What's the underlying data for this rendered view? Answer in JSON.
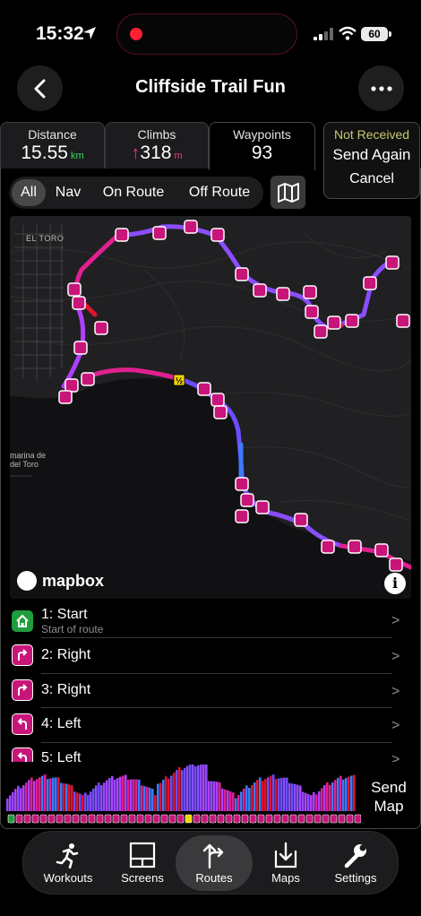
{
  "status_bar": {
    "time": "15:32",
    "battery": "60"
  },
  "header": {
    "title": "Cliffside Trail Fun"
  },
  "stats": {
    "distance": {
      "label": "Distance",
      "value": "15.55",
      "unit": "km"
    },
    "climbs": {
      "label": "Climbs",
      "arrow": "↑",
      "value": "318",
      "unit": "m"
    },
    "waypoints": {
      "label": "Waypoints",
      "value": "93"
    }
  },
  "sync_card": {
    "status": "Not Received",
    "send_again": "Send Again",
    "cancel": "Cancel"
  },
  "filters": {
    "all": "All",
    "nav": "Nav",
    "on_route": "On Route",
    "off_route": "Off Route",
    "selected": "All"
  },
  "map": {
    "labels": {
      "town_north": "EL TORO",
      "town_west_1": "marina de",
      "town_west_2": "del Toro"
    },
    "halfway_marker": "½",
    "attribution": "mapbox",
    "info": "i"
  },
  "waypoint_list": [
    {
      "name": "1: Start",
      "description": "Start of route",
      "icon": "home-icon"
    },
    {
      "name": "2: Right",
      "icon": "turn-right-icon"
    },
    {
      "name": "3: Right",
      "icon": "turn-right-icon"
    },
    {
      "name": "4: Left",
      "icon": "turn-left-icon"
    },
    {
      "name": "5: Left",
      "icon": "turn-left-icon"
    }
  ],
  "chevron": ">",
  "send_map": {
    "line1": "Send",
    "line2": "Map"
  },
  "tab_bar": [
    {
      "label": "Workouts",
      "icon": "runner-icon"
    },
    {
      "label": "Screens",
      "icon": "screens-icon"
    },
    {
      "label": "Routes",
      "icon": "routes-icon"
    },
    {
      "label": "Maps",
      "icon": "maps-download-icon"
    },
    {
      "label": "Settings",
      "icon": "wrench-icon"
    }
  ],
  "active_tab": "Routes",
  "colors": {
    "route_purple": "#8a4dff",
    "route_pink": "#e0208f",
    "route_red": "#e0142c",
    "waypoint_magenta": "#c8157a",
    "start_green": "#1f9d3c"
  }
}
